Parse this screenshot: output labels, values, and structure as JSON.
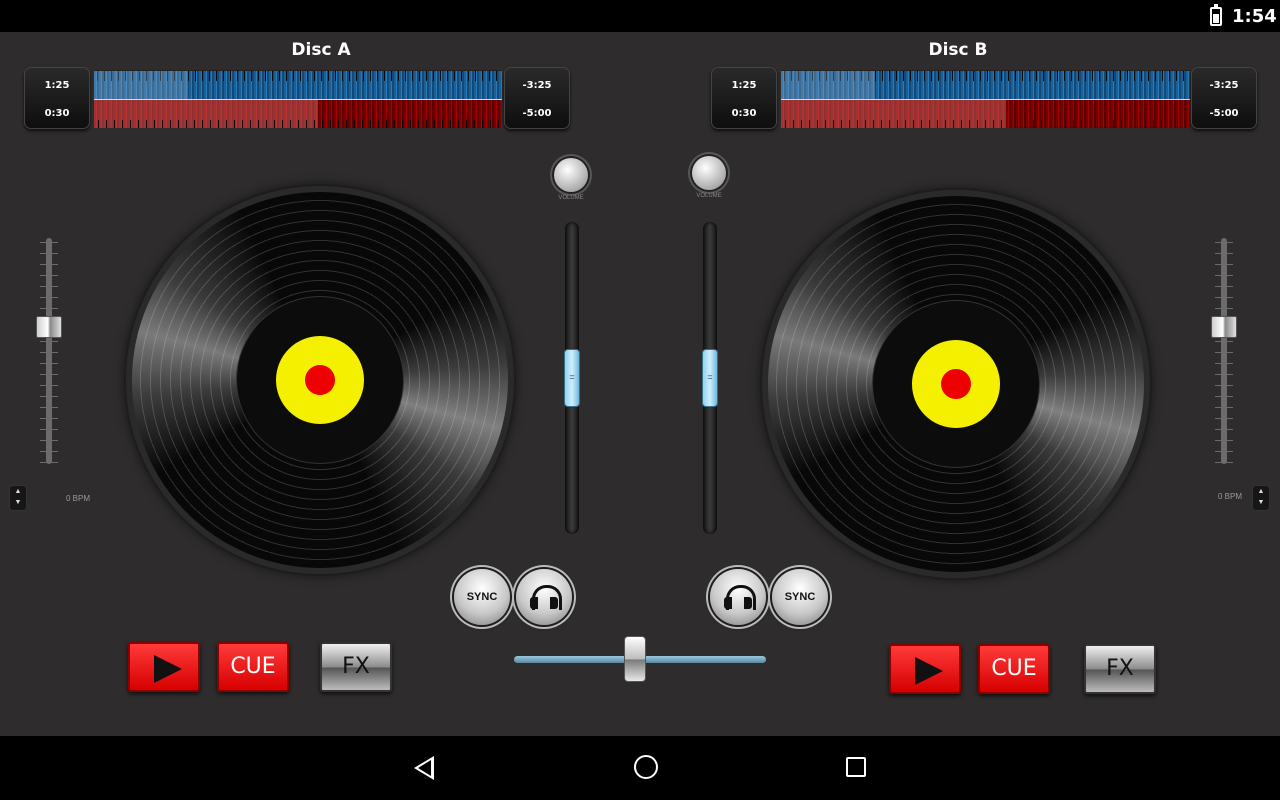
{
  "status_bar": {
    "time": "1:54"
  },
  "deck_a": {
    "title": "Disc A",
    "elapsed_top": "1:25",
    "elapsed_bottom": "0:30",
    "remaining_top": "-3:25",
    "remaining_bottom": "-5:00",
    "top_progress": 0.23,
    "bottom_progress": 0.55,
    "bpm": "0 BPM",
    "volume_label": "VOLUME",
    "sync_label": "SYNC",
    "cue_label": "CUE",
    "fx_label": "FX",
    "volume_level": 0.5,
    "pitch_level": 0.38
  },
  "deck_b": {
    "title": "Disc B",
    "elapsed_top": "1:25",
    "elapsed_bottom": "0:30",
    "remaining_top": "-3:25",
    "remaining_bottom": "-5:00",
    "top_progress": 0.23,
    "bottom_progress": 0.55,
    "bpm": "0 BPM",
    "volume_label": "VOLUME",
    "sync_label": "SYNC",
    "cue_label": "CUE",
    "fx_label": "FX",
    "volume_level": 0.5,
    "pitch_level": 0.38
  },
  "crossfader": {
    "position": 0.48
  },
  "colors": {
    "background": "#2e2c2d",
    "waveform_top": "#2a7ab8",
    "waveform_bottom": "#a40000",
    "button_red": "#ee0000",
    "label_yellow": "#f5f000",
    "label_red": "#ee0000",
    "volume_blue": "#8fd3ef"
  },
  "nav_bar": {
    "icons": [
      "back-icon",
      "home-icon",
      "recent-apps-icon"
    ]
  }
}
